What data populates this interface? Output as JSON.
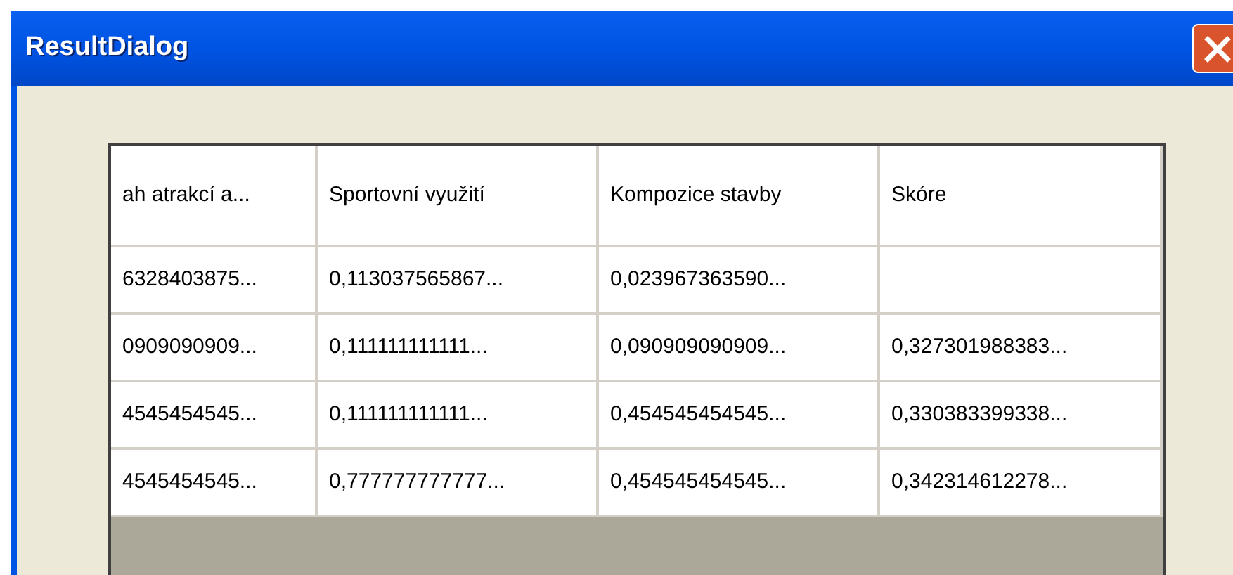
{
  "window": {
    "title": "ResultDialog"
  },
  "table": {
    "columns": [
      "ah atrakcí a...",
      "Sportovní využití",
      "Kompozice stavby",
      "Skóre"
    ],
    "rows": [
      [
        "6328403875...",
        "0,113037565867...",
        "0,023967363590..."
      ],
      [
        "0909090909...",
        "0,111111111111...",
        "0,090909090909...",
        "0,327301988383..."
      ],
      [
        "4545454545...",
        "0,111111111111...",
        "0,454545454545...",
        "0,330383399338..."
      ],
      [
        "4545454545...",
        "0,777777777777...",
        "0,454545454545...",
        "0,342314612278..."
      ]
    ]
  }
}
